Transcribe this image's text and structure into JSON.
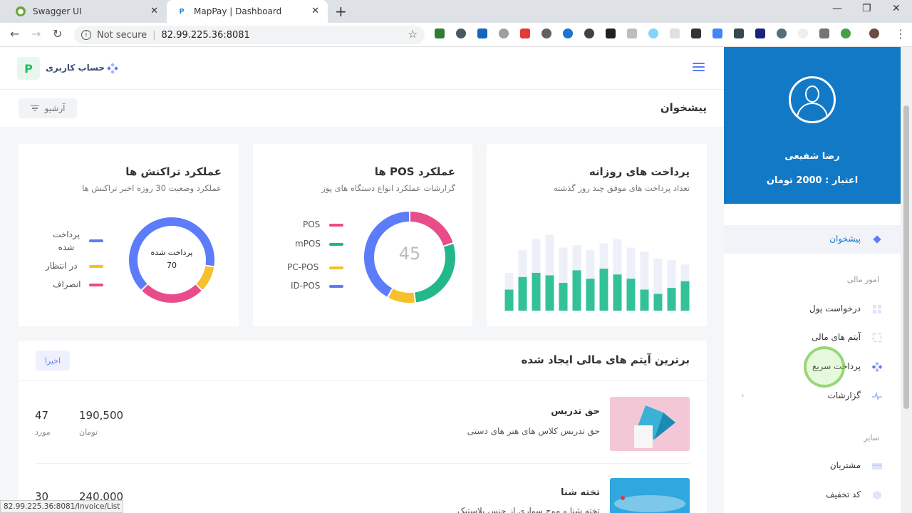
{
  "browser": {
    "tabs": [
      {
        "title": "Swagger UI",
        "favicon": "swagger-favicon"
      },
      {
        "title": "MapPay | Dashboard",
        "favicon": "mappay-favicon"
      }
    ],
    "security_label": "Not secure",
    "url": "82.99.225.36:8081",
    "status_url": "82.99.225.36:8081/Invoice/List"
  },
  "header": {
    "logo_letter": "P",
    "account_label": "حساب کاربری",
    "archive_label": "آرشیو",
    "page_title": "پیشخوان"
  },
  "sidebar": {
    "user_name": "رضا شفیعی",
    "credit": "اعتبار :  2000 تومان",
    "items": [
      {
        "label": "پیشخوان",
        "icon": "diamond-icon",
        "active": true
      },
      {
        "section": "امور مالی"
      },
      {
        "label": "درخواست پول",
        "icon": "grid-icon"
      },
      {
        "label": "آیتم های مالی",
        "icon": "frame-icon"
      },
      {
        "label": "پرداخت سریع",
        "icon": "diamonds-icon"
      },
      {
        "label": "گزارشات",
        "icon": "pulse-icon"
      },
      {
        "section": "سایر"
      },
      {
        "label": "مشتریان",
        "icon": "card-icon"
      },
      {
        "label": "کد تخفیف",
        "icon": "box-icon"
      }
    ]
  },
  "cards": {
    "daily": {
      "title": "پرداخت های روزانه",
      "subtitle": "تعداد پرداخت های موفق چند روز گذشته"
    },
    "pos": {
      "title": "عملکرد POS ها",
      "subtitle": "گزارشات عملکرد انواع دستگاه های پوز",
      "center_value": "45",
      "legend": [
        {
          "label": "POS",
          "color": "#e94c8b"
        },
        {
          "label": "mPOS",
          "color": "#22b88a"
        },
        {
          "label": "PC-POS",
          "color": "#f6c02c"
        },
        {
          "label": "ID-POS",
          "color": "#5c7cfa"
        }
      ]
    },
    "transactions": {
      "title": "عملکرد تراکنش ها",
      "subtitle": "عملکرد وضعیت 30 روزه اخیر تراکنش ها",
      "center_label": "پرداخت شده",
      "center_value": "70",
      "legend": [
        {
          "label": "پرداخت شده",
          "color": "#5c7cfa"
        },
        {
          "label": "در انتظار",
          "color": "#f6c02c"
        },
        {
          "label": "انصراف",
          "color": "#e94c8b"
        }
      ]
    }
  },
  "chart_data": [
    {
      "type": "bar",
      "values": [
        25,
        40,
        45,
        42,
        33,
        48,
        38,
        50,
        43,
        38,
        25,
        20,
        27,
        35
      ],
      "background_values": [
        45,
        72,
        85,
        90,
        75,
        78,
        72,
        80,
        85,
        75,
        70,
        62,
        60,
        55
      ],
      "colors": {
        "value": "#33c198",
        "background": "#eef0f9"
      }
    },
    {
      "type": "pie",
      "categories": [
        "POS",
        "mPOS",
        "PC-POS",
        "ID-POS"
      ],
      "values": [
        20,
        28,
        10,
        42
      ],
      "colors": [
        "#e94c8b",
        "#22b88a",
        "#f6c02c",
        "#5c7cfa"
      ]
    },
    {
      "type": "pie",
      "categories": [
        "پرداخت شده",
        "در انتظار",
        "انصراف"
      ],
      "values": [
        65,
        10,
        25
      ],
      "colors": [
        "#5c7cfa",
        "#f6c02c",
        "#e94c8b"
      ]
    }
  ],
  "list": {
    "title": "برترین آیتم های مالی ایجاد شده",
    "badge": "اخیرا",
    "items": [
      {
        "title": "حق تدریس",
        "desc": "حق تدریس کلاس های هنر های دستی",
        "amount": "190,500",
        "amount_unit": "تومان",
        "count": "47",
        "count_unit": "مورد"
      },
      {
        "title": "تخته شنا",
        "desc": "تخته شنا و موج سواری از جنس پلاستیک",
        "amount": "240,000",
        "amount_unit": "",
        "count": "30",
        "count_unit": ""
      }
    ]
  }
}
